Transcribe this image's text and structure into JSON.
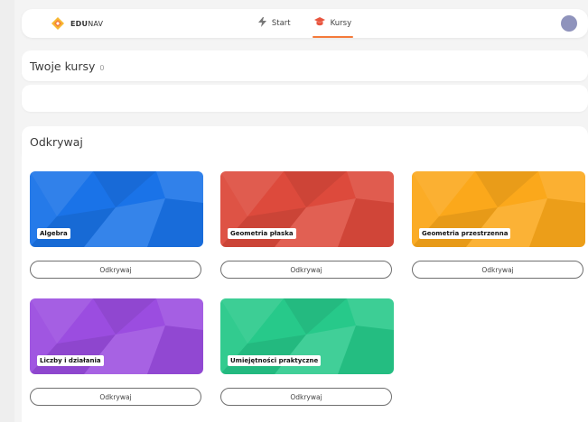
{
  "nav": {
    "logo_bold": "EDU",
    "logo_rest": "NAV",
    "links": [
      {
        "label": "Start",
        "icon": "lightning-icon"
      },
      {
        "label": "Kursy",
        "icon": "graduation-cap-icon",
        "active": true
      }
    ]
  },
  "courses": {
    "title": "Twoje kursy",
    "count": "0"
  },
  "discover": {
    "title": "Odkrywaj",
    "button_label": "Odkrywaj",
    "tiles": [
      {
        "label": "Algebra",
        "color": "#1a73e8"
      },
      {
        "label": "Geometria płaska",
        "color": "#dd4a3c"
      },
      {
        "label": "Geometria przestrzenna",
        "color": "#fba81b"
      },
      {
        "label": "Liczby i działania",
        "color": "#9b4de0"
      },
      {
        "label": "Umiejętności praktyczne",
        "color": "#27c98a"
      }
    ]
  }
}
